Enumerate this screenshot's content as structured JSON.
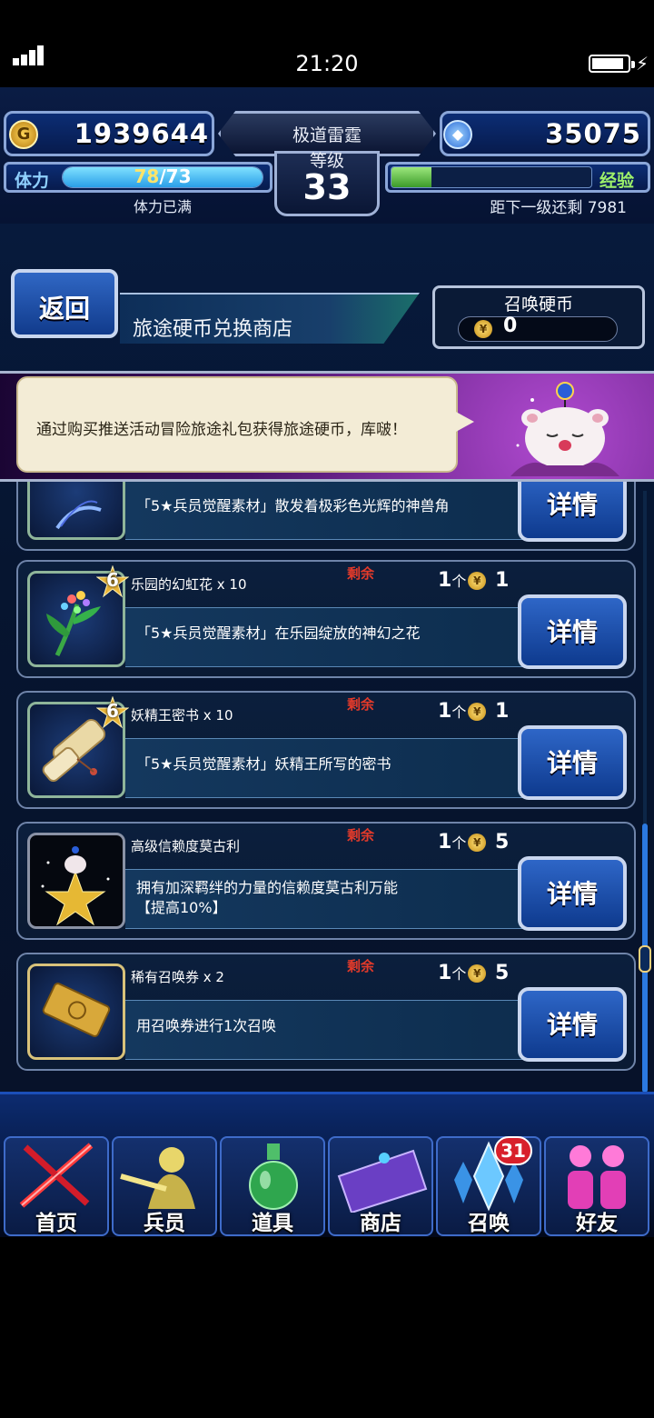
{
  "status_bar": {
    "time": "21:20"
  },
  "header": {
    "gil": "1939644",
    "gems": "35075",
    "rank_title": "极道雷霆",
    "level_label": "等级",
    "level": "33",
    "stamina_label": "体力",
    "stamina_current": "78",
    "stamina_max": "/73",
    "stamina_fraction": 1.0,
    "stamina_status": "体力已满",
    "exp_label": "经验",
    "exp_fraction": 0.2,
    "exp_remaining": "距下一级还剩 7981"
  },
  "shop": {
    "back_label": "返回",
    "title": "旅途硬币兑换商店",
    "currency_title": "召唤硬币",
    "currency_value": "0"
  },
  "banner": {
    "message": "通过购买推送活动冒险旅途礼包获得旅途硬币，库啵！"
  },
  "items": [
    {
      "name": "",
      "remain": "",
      "qty": "",
      "price": "",
      "desc": "「5★兵员觉醒素材」散发着极彩色光辉的神兽角",
      "detail": "详情",
      "icon": "horn-icon"
    },
    {
      "name": "乐园的幻虹花 x 10",
      "stars": "6",
      "remain": "剩余",
      "qty": "1",
      "qty_unit": "个",
      "price": "1",
      "desc": "「5★兵员觉醒素材」在乐园绽放的神幻之花",
      "detail": "详情",
      "icon": "flower-icon"
    },
    {
      "name": "妖精王密书 x 10",
      "stars": "6",
      "remain": "剩余",
      "qty": "1",
      "qty_unit": "个",
      "price": "1",
      "desc": "「5★兵员觉醒素材」妖精王所写的密书",
      "detail": "详情",
      "icon": "scroll-icon"
    },
    {
      "name": "高级信赖度莫古利",
      "remain": "剩余",
      "qty": "1",
      "qty_unit": "个",
      "price": "5",
      "desc": "拥有加深羁绊的力量的信赖度莫古利万能",
      "desc2": "【提高10%】",
      "detail": "详情",
      "icon": "moogle-star-icon"
    },
    {
      "name": "稀有召唤券 x 2",
      "remain": "剩余",
      "qty": "1",
      "qty_unit": "个",
      "price": "5",
      "desc": "用召唤券进行1次召唤",
      "detail": "详情",
      "icon": "ticket-icon"
    }
  ],
  "nav": [
    {
      "label": "首页",
      "icon": "home-swords-icon"
    },
    {
      "label": "兵员",
      "icon": "units-icon"
    },
    {
      "label": "道具",
      "icon": "potion-icon"
    },
    {
      "label": "商店",
      "icon": "shop-icon"
    },
    {
      "label": "召唤",
      "icon": "crystal-icon",
      "badge": "31"
    },
    {
      "label": "好友",
      "icon": "friends-icon"
    }
  ],
  "colors": {
    "accent_blue": "#2e66c7",
    "remain_red": "#e33a2a",
    "badge_red": "#d8202b"
  }
}
